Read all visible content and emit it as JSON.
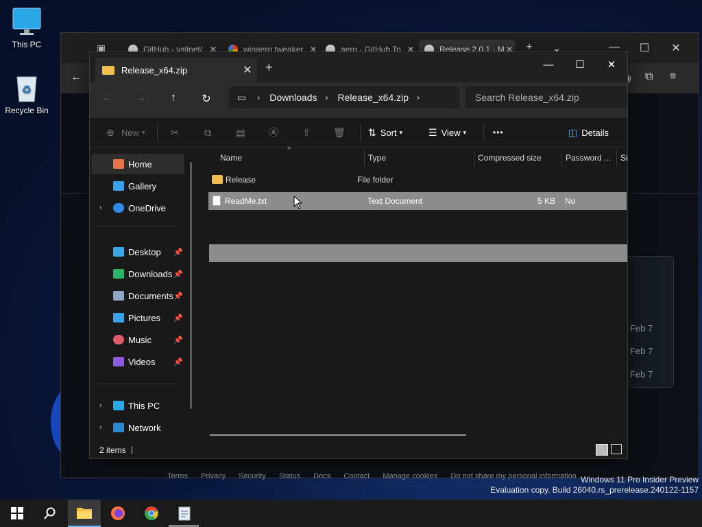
{
  "desktop": {
    "icons": [
      {
        "label": "This PC",
        "icon": "monitor-icon"
      },
      {
        "label": "Recycle Bin",
        "icon": "recycle-bin-icon"
      }
    ],
    "watermark": {
      "line1": "Windows 11 Pro Insider Preview",
      "line2": "Evaluation copy. Build 26040.rs_prerelease.240122-1157"
    }
  },
  "browser": {
    "tabs": [
      {
        "title": "GitHub - valinet/",
        "icon": "github-icon"
      },
      {
        "title": "winaero tweaker",
        "icon": "google-icon"
      },
      {
        "title": "aero · GitHub To",
        "icon": "github-icon"
      },
      {
        "title": "Release 2.0.1 · M",
        "icon": "github-icon"
      }
    ],
    "page": {
      "dates": [
        "Feb 7",
        "Feb 7",
        "Feb 7"
      ],
      "footer": [
        "Terms",
        "Privacy",
        "Security",
        "Status",
        "Docs",
        "Contact",
        "Manage cookies",
        "Do not share my personal information"
      ]
    }
  },
  "explorer": {
    "tab_title": "Release_x64.zip",
    "breadcrumb": [
      "Downloads",
      "Release_x64.zip"
    ],
    "search_placeholder": "Search Release_x64.zip",
    "commands": {
      "new": "New",
      "sort": "Sort",
      "view": "View",
      "more": "•••",
      "details": "Details"
    },
    "nav": {
      "home": "Home",
      "gallery": "Gallery",
      "onedrive": "OneDrive",
      "desktop": "Desktop",
      "downloads": "Downloads",
      "documents": "Documents",
      "pictures": "Pictures",
      "music": "Music",
      "videos": "Videos",
      "thispc": "This PC",
      "network": "Network"
    },
    "columns": [
      "Name",
      "Type",
      "Compressed size",
      "Password ...",
      "Si"
    ],
    "rows": [
      {
        "name": "Release",
        "type": "File folder",
        "size": "",
        "password": ""
      },
      {
        "name": "ReadMe.txt",
        "type": "Text Document",
        "size": "5 KB",
        "password": "No"
      }
    ],
    "status": "2 items",
    "colors": {
      "accent": "#6cb4ff",
      "folder": "#f2c04a",
      "selected_row": "#8c8c8c"
    }
  }
}
